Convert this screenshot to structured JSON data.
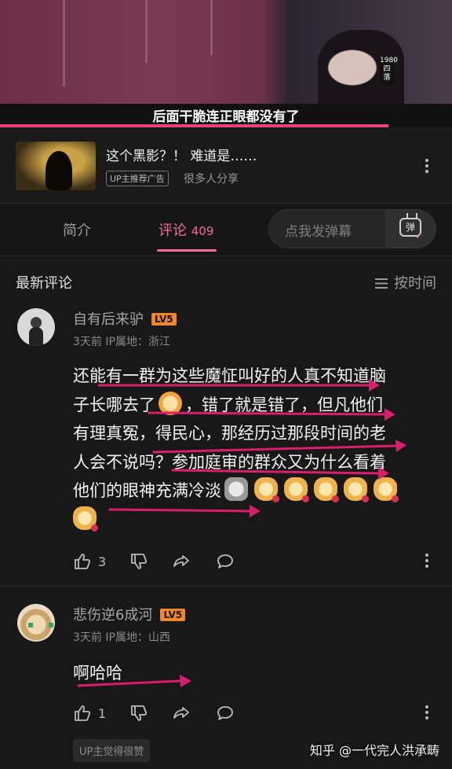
{
  "video": {
    "subtitle": "后面干脆连正眼都没有了",
    "sign_text": "1980 四 落",
    "progress": 0.86
  },
  "ad": {
    "title": "这个黑影？！ 难道是……",
    "badge": "UP主推荐广告",
    "shares": "很多人分享"
  },
  "tabs": {
    "intro": "简介",
    "comments": "评论",
    "comments_count": "409",
    "danmu_placeholder": "点我发弹幕",
    "danmu_button": "弹"
  },
  "section": {
    "title": "最新评论",
    "sort": "按时间"
  },
  "comments": [
    {
      "username": "自有后来驴",
      "level": "LV5",
      "time": "3天前",
      "ip_label": "IP属地：",
      "ip": "浙江",
      "lines": [
        "还能有一群为这些魔怔叫好的人真不知道脑",
        "子长哪去了",
        "，错了就是错了，但凡他们",
        "有理真冤，得民心，那经历过那段时间的老",
        "人会不说吗？参加庭审的群众又为什么看着",
        "他们的眼神充满冷淡"
      ],
      "likes": "3"
    },
    {
      "username": "悲伤逆6成河",
      "level": "LV5",
      "time": "3天前",
      "ip_label": "IP属地：",
      "ip": "山西",
      "text": "啊哈哈",
      "likes": "1"
    }
  ],
  "up_badge": "UP主觉得很赞",
  "watermark": "知乎 @一代完人洪承畴",
  "accent_color": "#f46b9a",
  "level_color": "#f0862a",
  "annotation_color": "#d81f6b"
}
